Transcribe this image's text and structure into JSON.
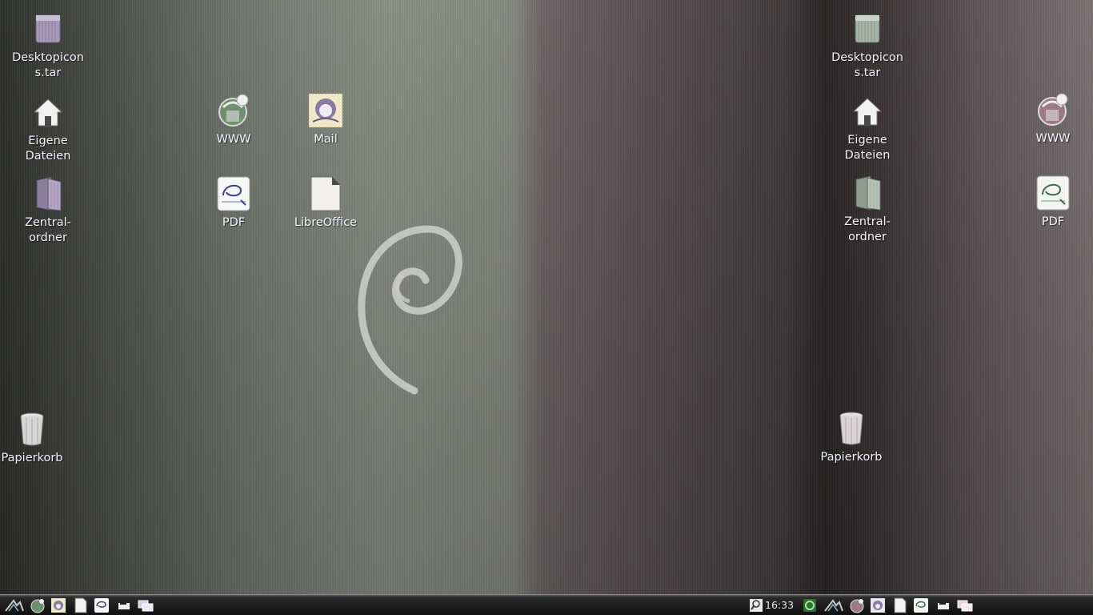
{
  "desktop": {
    "left_screen": {
      "icons": [
        {
          "label": "Desktopicon\ns.tar",
          "icon": "archive-icon"
        },
        {
          "label": "Eigene\nDateien",
          "icon": "home-icon"
        },
        {
          "label": "Zentral-\nordner",
          "icon": "folder-icon"
        },
        {
          "label": "WWW",
          "icon": "browser-icon"
        },
        {
          "label": "Mail",
          "icon": "mail-icon"
        },
        {
          "label": "PDF",
          "icon": "pdf-icon"
        },
        {
          "label": "LibreOffice",
          "icon": "document-icon"
        },
        {
          "label": "Papierkorb",
          "icon": "trash-icon"
        }
      ]
    },
    "right_screen": {
      "icons": [
        {
          "label": "Desktopicon\ns.tar",
          "icon": "archive-icon"
        },
        {
          "label": "Eigene\nDateien",
          "icon": "home-icon"
        },
        {
          "label": "Zentral-\nordner",
          "icon": "folder-icon"
        },
        {
          "label": "WWW",
          "icon": "browser-icon"
        },
        {
          "label": "PDF",
          "icon": "pdf-icon"
        },
        {
          "label": "Papierkorb",
          "icon": "trash-icon"
        }
      ]
    },
    "wallpaper": "debian-swirl",
    "colors": {
      "left_bg": "#868a81",
      "right_bg": "#5a5254",
      "label": "#f4f4ff",
      "taskbar": "#1a1a1a"
    }
  },
  "taskbar": {
    "clock": "16:33",
    "left_launchers": [
      "menu-icon",
      "browser-icon",
      "mail-icon",
      "document-icon",
      "pdf-icon",
      "show-desktop-icon",
      "windows-icon"
    ],
    "tray": [
      "search-icon",
      "network-icon"
    ],
    "right_launchers": [
      "menu-icon",
      "browser-icon",
      "mail-icon",
      "document-icon",
      "pdf-icon",
      "show-desktop-icon",
      "windows-icon"
    ]
  }
}
